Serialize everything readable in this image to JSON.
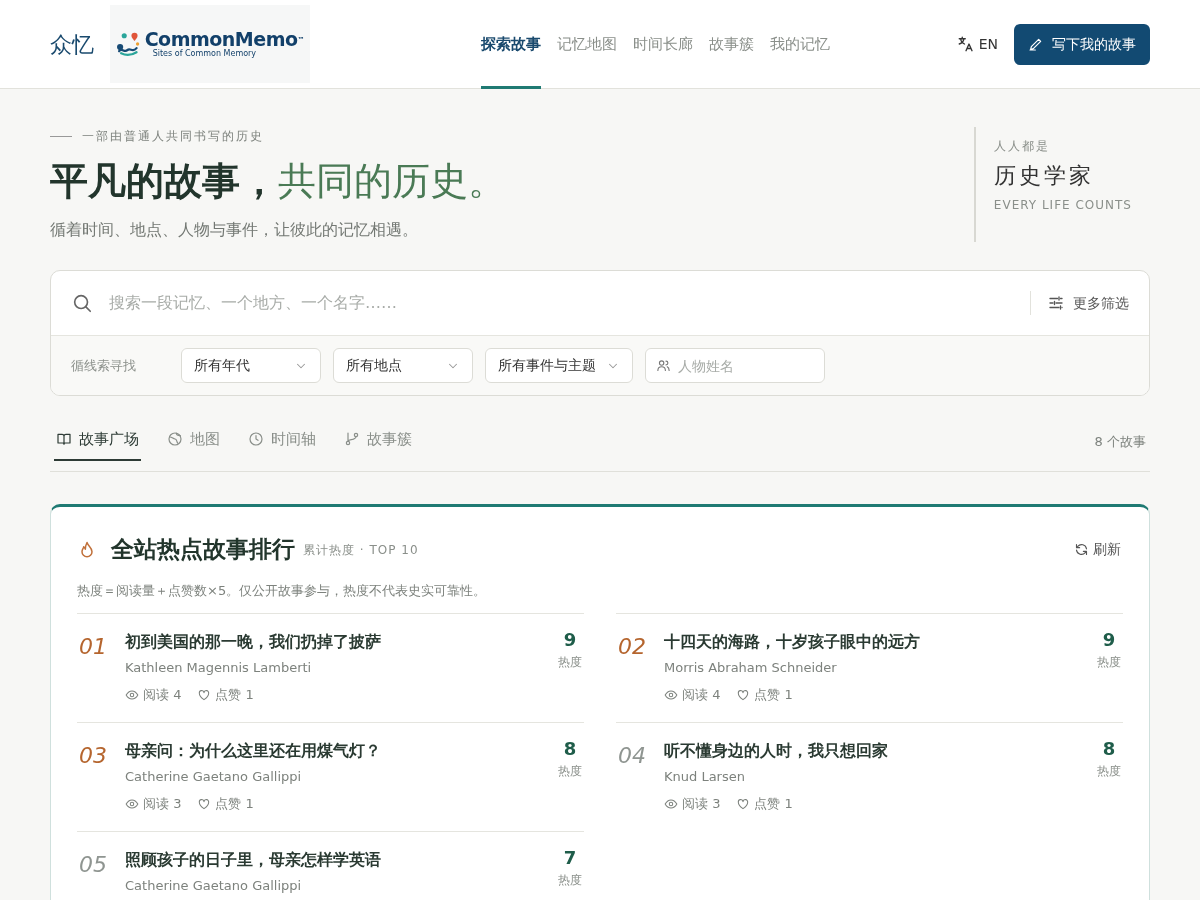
{
  "brand": {
    "name": "众忆",
    "logo_title": "CommonMemo",
    "logo_tm": "™",
    "logo_subtitle": "Sites of Common Memory"
  },
  "nav": [
    {
      "label": "探索故事",
      "selected": true
    },
    {
      "label": "记忆地图",
      "selected": false
    },
    {
      "label": "时间长廊",
      "selected": false
    },
    {
      "label": "故事簇",
      "selected": false
    },
    {
      "label": "我的记忆",
      "selected": false
    }
  ],
  "language": "EN",
  "write_button": "写下我的故事",
  "hero": {
    "eyebrow": "一部由普通人共同书写的历史",
    "title": "平凡的故事，",
    "title_accent": "共同的历史。",
    "subtitle": "循着时间、地点、人物与事件，让彼此的记忆相遇。",
    "aside_small": "人人都是",
    "aside_big": "历史学家",
    "aside_caption": "EVERY LIFE COUNTS"
  },
  "search": {
    "placeholder": "搜索一段记忆、一个地方、一个名字……",
    "more_filters": "更多筛选",
    "filter_label": "循线索寻找",
    "filters": [
      {
        "kind": "select",
        "value": "所有年代"
      },
      {
        "kind": "select",
        "value": "所有地点"
      },
      {
        "kind": "select",
        "value": "所有事件与主题"
      },
      {
        "kind": "input",
        "placeholder": "人物姓名"
      }
    ]
  },
  "views": [
    {
      "label": "故事广场",
      "selected": true
    },
    {
      "label": "地图",
      "selected": false
    },
    {
      "label": "时间轴",
      "selected": false
    },
    {
      "label": "故事簇",
      "selected": false
    }
  ],
  "story_count": "8 个故事",
  "ranking": {
    "title": "全站热点故事排行",
    "tag": "累计热度 · TOP 10",
    "refresh": "刷新",
    "note": "热度＝阅读量＋点赞数×5。仅公开故事参与，热度不代表史实可靠性。",
    "items": [
      {
        "rank": "01",
        "top": true,
        "title": "初到美国的那一晚，我们扔掉了披萨",
        "author": "Kathleen Magennis Lamberti",
        "reads": "阅读 4",
        "likes": "点赞 1",
        "score": "9",
        "score_label": "热度"
      },
      {
        "rank": "02",
        "top": true,
        "title": "十四天的海路，十岁孩子眼中的远方",
        "author": "Morris Abraham Schneider",
        "reads": "阅读 4",
        "likes": "点赞 1",
        "score": "9",
        "score_label": "热度"
      },
      {
        "rank": "03",
        "top": true,
        "title": "母亲问：为什么这里还在用煤气灯？",
        "author": "Catherine Gaetano Gallippi",
        "reads": "阅读 3",
        "likes": "点赞 1",
        "score": "8",
        "score_label": "热度"
      },
      {
        "rank": "04",
        "top": false,
        "title": "听不懂身边的人时，我只想回家",
        "author": "Knud Larsen",
        "reads": "阅读 3",
        "likes": "点赞 1",
        "score": "8",
        "score_label": "热度"
      },
      {
        "rank": "05",
        "top": false,
        "title": "照顾孩子的日子里，母亲怎样学英语",
        "author": "Catherine Gaetano Gallippi",
        "score": "7",
        "score_label": "热度"
      }
    ]
  }
}
